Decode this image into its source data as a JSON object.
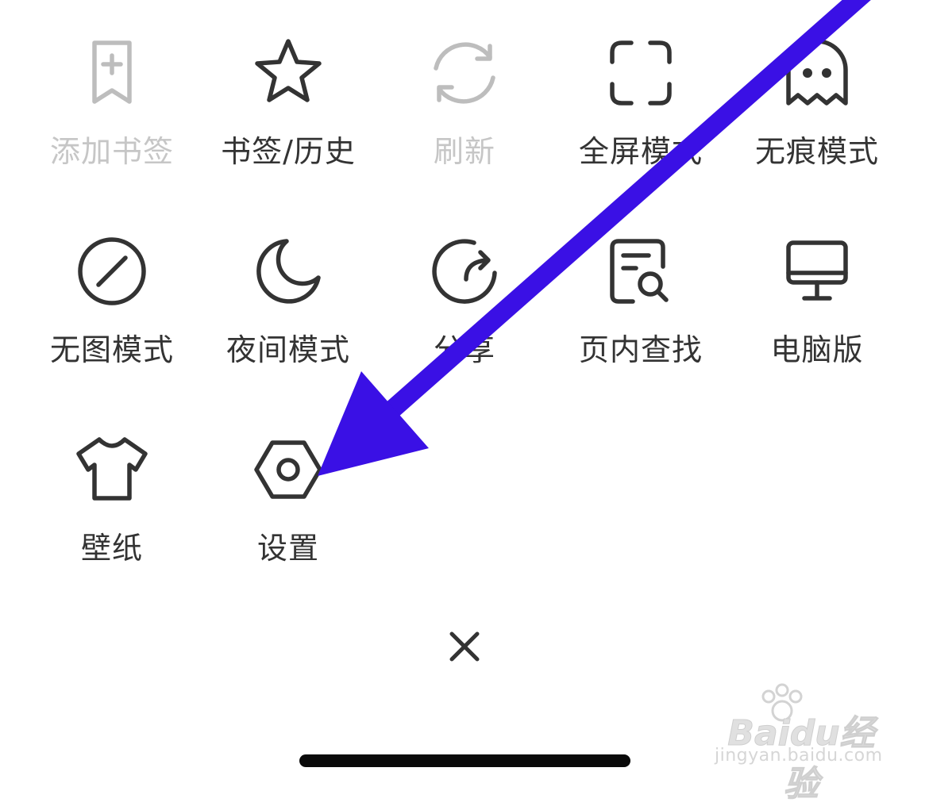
{
  "menu": {
    "row1": [
      {
        "label": "添加书签",
        "icon": "bookmark-add-icon",
        "disabled": true
      },
      {
        "label": "书签/历史",
        "icon": "star-icon",
        "disabled": false
      },
      {
        "label": "刷新",
        "icon": "refresh-icon",
        "disabled": true
      },
      {
        "label": "全屏模式",
        "icon": "fullscreen-icon",
        "disabled": false
      },
      {
        "label": "无痕模式",
        "icon": "ghost-icon",
        "disabled": false
      }
    ],
    "row2": [
      {
        "label": "无图模式",
        "icon": "no-image-icon",
        "disabled": false
      },
      {
        "label": "夜间模式",
        "icon": "moon-icon",
        "disabled": false
      },
      {
        "label": "分享",
        "icon": "share-icon",
        "disabled": false
      },
      {
        "label": "页内查找",
        "icon": "find-in-page-icon",
        "disabled": false
      },
      {
        "label": "电脑版",
        "icon": "desktop-icon",
        "disabled": false
      }
    ],
    "row3": [
      {
        "label": "壁纸",
        "icon": "tshirt-icon",
        "disabled": false
      },
      {
        "label": "设置",
        "icon": "settings-hex-icon",
        "disabled": false
      }
    ]
  },
  "close": {
    "icon": "close-icon"
  },
  "watermark": {
    "logo": "Baidu经验",
    "url": "jingyan.baidu.com"
  },
  "colors": {
    "arrow": "#3a10e5",
    "icon": "#333333",
    "disabled": "#bdbdbd",
    "text": "#333333"
  }
}
